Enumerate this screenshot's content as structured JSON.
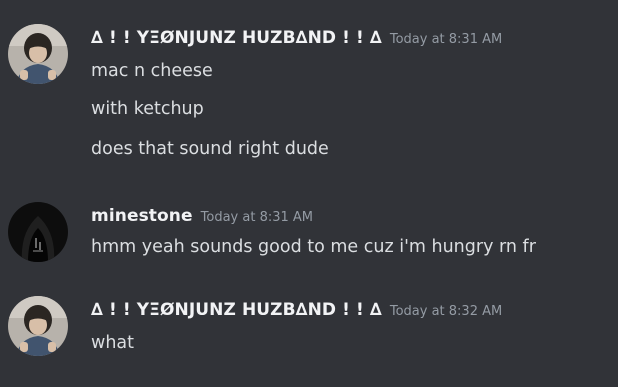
{
  "messages": [
    {
      "author": "∆ ! ! YΞØNJUNZ HUZB∆ND ! ! ∆",
      "timestamp": "Today at 8:31 AM",
      "avatar_icon": "user-avatar-photo",
      "lines": [
        "mac n cheese",
        "with ketchup",
        "does that sound right dude"
      ]
    },
    {
      "author": "minestone",
      "timestamp": "Today at 8:31 AM",
      "avatar_icon": "hooded-figure-avatar",
      "lines": [
        "hmm yeah sounds good to me cuz i'm hungry rn fr"
      ]
    },
    {
      "author": "∆ ! ! YΞØNJUNZ HUZB∆ND ! ! ∆",
      "timestamp": "Today at 8:32 AM",
      "avatar_icon": "user-avatar-photo",
      "lines": [
        "what"
      ]
    }
  ],
  "colors": {
    "background": "#313338",
    "username": "#f2f3f5",
    "timestamp": "#949ba4",
    "message_text": "#dbdee1"
  }
}
